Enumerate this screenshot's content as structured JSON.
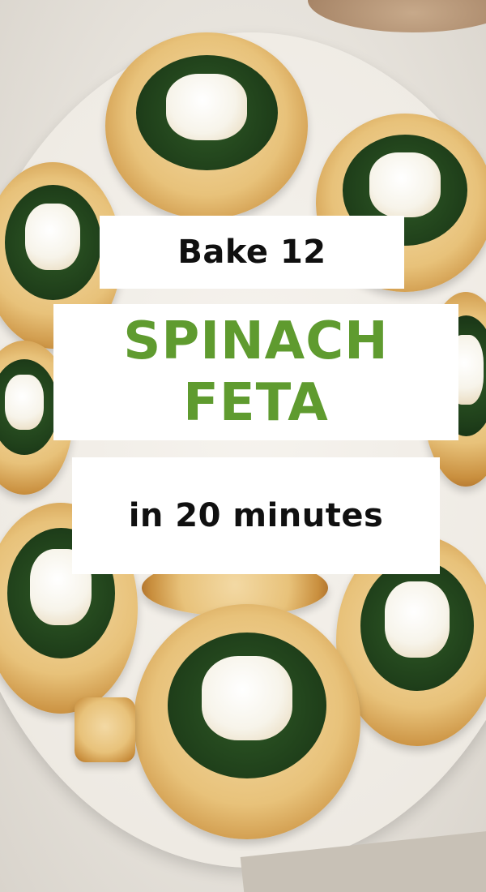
{
  "overlay": {
    "line1": "Bake 12",
    "line2": "SPINACH",
    "line3": "FETA",
    "line4": "in 20 minutes",
    "accent_color": "#5f9b2f",
    "text_color": "#101010",
    "card_color": "#ffffff"
  },
  "photo": {
    "subject_icon": "spinach-feta-pastry-bites"
  }
}
